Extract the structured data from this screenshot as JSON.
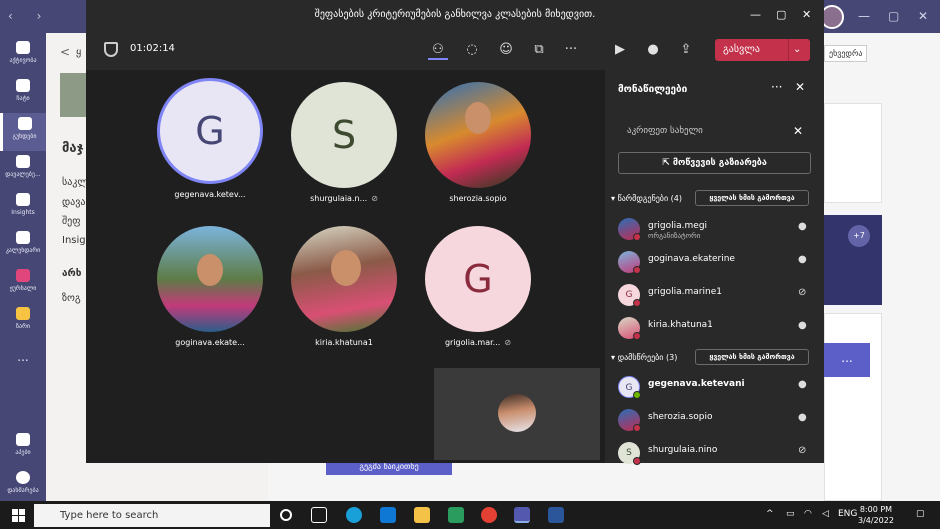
{
  "rail": [
    {
      "label": "აქტივობა",
      "icon": "bell-icon"
    },
    {
      "label": "ჩატი",
      "icon": "chat-icon"
    },
    {
      "label": "გუნდები",
      "icon": "teams-icon",
      "active": true
    },
    {
      "label": "დავალებე...",
      "icon": "assignments-icon"
    },
    {
      "label": "Insights",
      "icon": "insights-icon"
    },
    {
      "label": "კალენდარი",
      "icon": "calendar-icon"
    },
    {
      "label": "ჟურნალი",
      "icon": "journal-icon"
    },
    {
      "label": "ზარი",
      "icon": "call-icon"
    },
    {
      "label": "...",
      "icon": "more-icon"
    },
    {
      "label": "აპები",
      "icon": "apps-icon"
    },
    {
      "label": "დახმარება",
      "icon": "help-icon"
    }
  ],
  "team_bg": {
    "back": "<",
    "back_text": "ყ",
    "title": "მაჯ",
    "lines": [
      "საკლ",
      "დავა",
      "შეფ",
      "Insig"
    ],
    "section": "არხ",
    "channel": "ზოგ"
  },
  "right_bg": {
    "top_label": "ეხვედრა",
    "plus_badge": "+7",
    "more": "..."
  },
  "bottom_button": "გეგმა წაიკითხე",
  "meeting": {
    "title": "შეფასების კრიტერიუმების განხილვა კლასების მიხედვით.",
    "timer": "01:02:14",
    "leave_label": "გასვლა",
    "leave_icon": "phone-hangup-icon"
  },
  "tiles": [
    {
      "name": "gegenava.ketev...",
      "initial": "G",
      "style": "g1",
      "muted": false
    },
    {
      "name": "shurgulaia.n...",
      "initial": "S",
      "style": "s",
      "muted": true
    },
    {
      "name": "sherozia.sopio",
      "initial": "",
      "style": "photo",
      "muted": false
    },
    {
      "name": "goginava.ekate...",
      "initial": "",
      "style": "photo2",
      "muted": false
    },
    {
      "name": "kiria.khatuna1",
      "initial": "",
      "style": "photo3",
      "muted": false
    },
    {
      "name": "grigolia.mar...",
      "initial": "G",
      "style": "g2",
      "muted": true
    }
  ],
  "panel": {
    "title": "მონაწილეები",
    "search_placeholder": "აკრიფეთ სახელი",
    "share_label": "მოწვევის გაზიარება",
    "presenters_label": "წარმდგენები (4)",
    "attendees_label": "დამსწრეები (3)",
    "mute_all_label": "ყველას ხმის გამორთვა",
    "presenters": [
      {
        "name": "grigolia.megi",
        "role": "ორგანიზატორი",
        "mic": "on"
      },
      {
        "name": "goginava.ekaterine",
        "role": "",
        "mic": "on"
      },
      {
        "name": "grigolia.marine1",
        "role": "",
        "mic": "off",
        "initial": "G"
      },
      {
        "name": "kiria.khatuna1",
        "role": "",
        "mic": "on"
      }
    ],
    "attendees": [
      {
        "name": "gegenava.ketevani",
        "role": "",
        "mic": "on",
        "initial": "G",
        "bold": true
      },
      {
        "name": "sherozia.sopio",
        "role": "",
        "mic": "on"
      },
      {
        "name": "shurgulaia.nino",
        "role": "",
        "mic": "off",
        "initial": "S"
      }
    ]
  },
  "taskbar": {
    "search_placeholder": "Type here to search",
    "lang": "ENG",
    "time": "8:00 PM",
    "date": "3/4/2022"
  }
}
